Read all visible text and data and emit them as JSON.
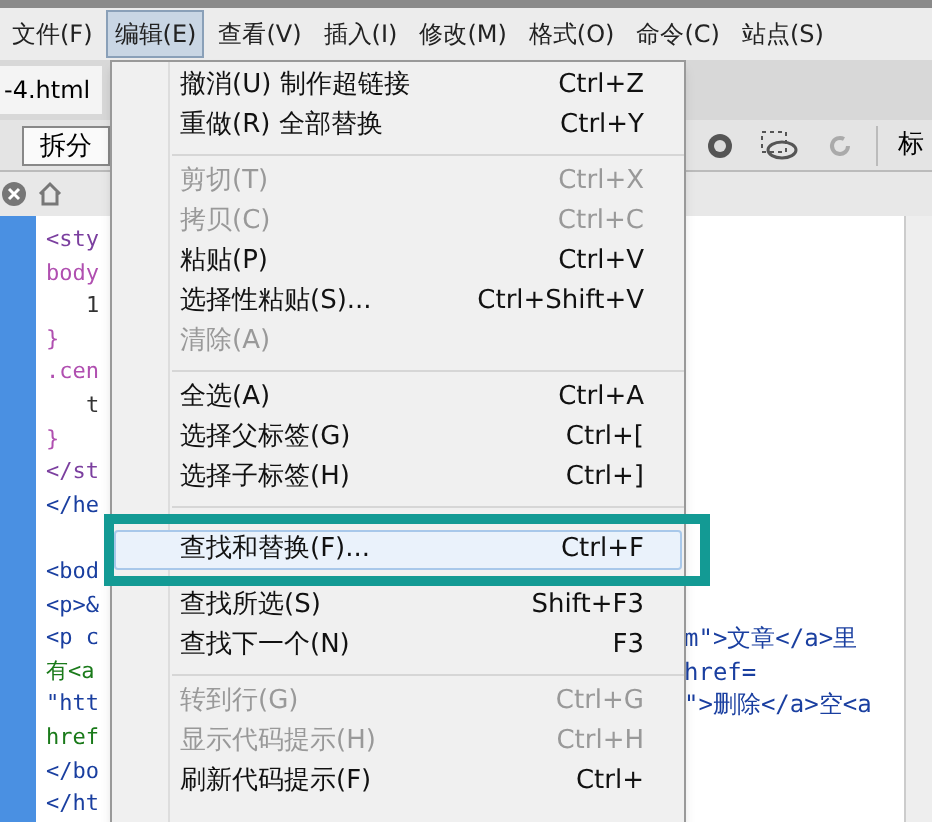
{
  "menu_bar": [
    {
      "label": "文件(F)",
      "selected": false
    },
    {
      "label": "编辑(E)",
      "selected": true
    },
    {
      "label": "查看(V)",
      "selected": false
    },
    {
      "label": "插入(I)",
      "selected": false
    },
    {
      "label": "修改(M)",
      "selected": false
    },
    {
      "label": "格式(O)",
      "selected": false
    },
    {
      "label": "命令(C)",
      "selected": false
    },
    {
      "label": "站点(S)",
      "selected": false
    }
  ],
  "document_tab": "-4.html",
  "toolbar": {
    "split_button": "拆分",
    "title_label": "标"
  },
  "code_lines": [
    {
      "text": "<sty",
      "color": "#7b3f9f"
    },
    {
      "text": "body",
      "color": "#b04fb0"
    },
    {
      "text": "1",
      "color": "#333333",
      "indent": true
    },
    {
      "text": "}",
      "color": "#b04fb0"
    },
    {
      "text": ".cen",
      "color": "#b04fb0"
    },
    {
      "text": "t",
      "color": "#333333",
      "indent": true
    },
    {
      "text": "}",
      "color": "#b04fb0"
    },
    {
      "text": "</st",
      "color": "#7b3f9f"
    },
    {
      "text": "</he",
      "color": "#1a3fa0"
    },
    {
      "text": "<bod",
      "color": "#1a3fa0",
      "blank_before": true
    },
    {
      "text": "<p>&",
      "color": "#1a3fa0"
    },
    {
      "text": "<p c",
      "color": "#1a3fa0"
    },
    {
      "text": "有<a",
      "color": "#1a7a1a"
    },
    {
      "text": "\"htt",
      "color": "#1a3fa0"
    },
    {
      "text": "href",
      "color": "#1a7a1a"
    },
    {
      "text": "</bo",
      "color": "#1a3fa0"
    },
    {
      "text": "</ht",
      "color": "#1a3fa0"
    }
  ],
  "code_right": [
    {
      "text": "m\">文章</a>里"
    },
    {
      "text": "href="
    },
    {
      "text": "\">删除</a>空<a"
    }
  ],
  "edit_menu": [
    {
      "kind": "item",
      "label": "撤消(U) 制作超链接",
      "shortcut": "Ctrl+Z",
      "disabled": false,
      "selected": false
    },
    {
      "kind": "item",
      "label": "重做(R) 全部替换",
      "shortcut": "Ctrl+Y",
      "disabled": false,
      "selected": false
    },
    {
      "kind": "separator"
    },
    {
      "kind": "item",
      "label": "剪切(T)",
      "shortcut": "Ctrl+X",
      "disabled": true,
      "selected": false
    },
    {
      "kind": "item",
      "label": "拷贝(C)",
      "shortcut": "Ctrl+C",
      "disabled": true,
      "selected": false
    },
    {
      "kind": "item",
      "label": "粘贴(P)",
      "shortcut": "Ctrl+V",
      "disabled": false,
      "selected": false
    },
    {
      "kind": "item",
      "label": "选择性粘贴(S)...",
      "shortcut": "Ctrl+Shift+V",
      "disabled": false,
      "selected": false
    },
    {
      "kind": "item",
      "label": "清除(A)",
      "disabled": true,
      "selected": false
    },
    {
      "kind": "separator"
    },
    {
      "kind": "item",
      "label": "全选(A)",
      "shortcut": "Ctrl+A",
      "disabled": false,
      "selected": false
    },
    {
      "kind": "item",
      "label": "选择父标签(G)",
      "shortcut": "Ctrl+[",
      "disabled": false,
      "selected": false
    },
    {
      "kind": "item",
      "label": "选择子标签(H)",
      "shortcut": "Ctrl+]",
      "disabled": false,
      "selected": false
    },
    {
      "kind": "separator"
    },
    {
      "kind": "item",
      "label": "查找和替换(F)...",
      "shortcut": "Ctrl+F",
      "disabled": false,
      "selected": true
    },
    {
      "kind": "item",
      "label": "查找所选(S)",
      "shortcut": "Shift+F3",
      "disabled": false,
      "selected": false
    },
    {
      "kind": "item",
      "label": "查找下一个(N)",
      "shortcut": "F3",
      "disabled": false,
      "selected": false
    },
    {
      "kind": "separator"
    },
    {
      "kind": "item",
      "label": "转到行(G)",
      "shortcut": "Ctrl+G",
      "disabled": true,
      "selected": false
    },
    {
      "kind": "item",
      "label": "显示代码提示(H)",
      "shortcut": "Ctrl+H",
      "disabled": true,
      "selected": false
    },
    {
      "kind": "item",
      "label": "刷新代码提示(F)",
      "shortcut": "Ctrl+",
      "disabled": false,
      "selected": false
    }
  ]
}
